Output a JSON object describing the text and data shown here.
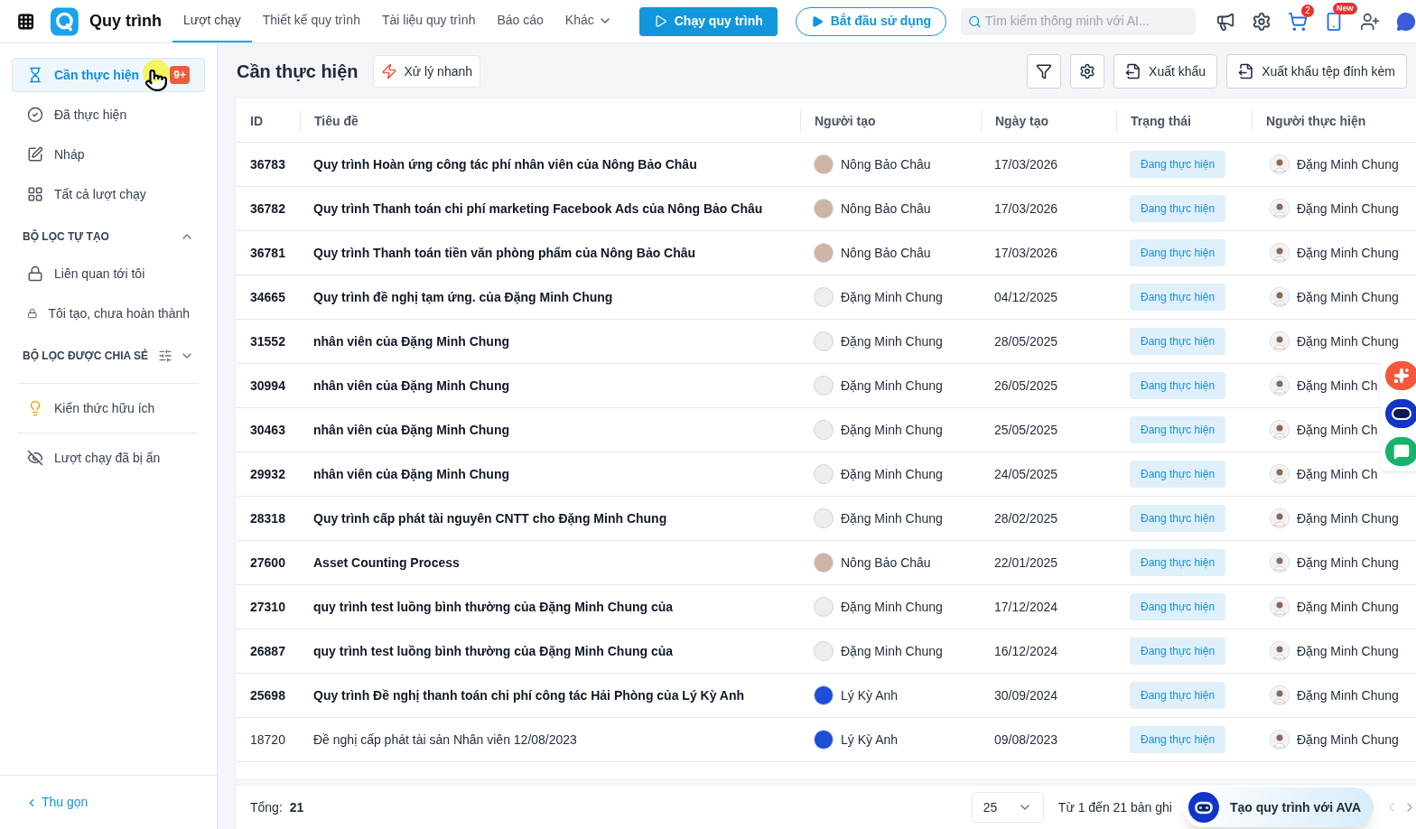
{
  "app": {
    "title": "Quy trình"
  },
  "nav_tabs": [
    {
      "label": "Lượt chạy",
      "selected": true
    },
    {
      "label": "Thiết kế quy trình",
      "selected": false
    },
    {
      "label": "Tài liệu quy trình",
      "selected": false
    },
    {
      "label": "Báo cáo",
      "selected": false
    },
    {
      "label": "Khác",
      "selected": false,
      "dropdown": true
    }
  ],
  "buttons": {
    "run": "Chạy quy trình",
    "start": "Bắt đầu sử dụng"
  },
  "search": {
    "placeholder": "Tìm kiếm thông minh với AI..."
  },
  "header_badges": {
    "cart": "2",
    "phone": "New"
  },
  "sidebar": {
    "items": [
      {
        "label": "Cần thực hiện",
        "selected": true,
        "badge": "9+"
      },
      {
        "label": "Đã thực hiện",
        "selected": false
      },
      {
        "label": "Nháp",
        "selected": false
      },
      {
        "label": "Tất cả lượt chạy",
        "selected": false
      }
    ],
    "sections": [
      {
        "title": "BỘ LỌC TỰ TẠO",
        "expanded": true,
        "items": [
          {
            "label": "Liên quan tới tôi",
            "selected": false
          },
          {
            "label": "Tôi tạo, chưa hoàn thành",
            "selected": false
          }
        ]
      },
      {
        "title": "BỘ LỌC ĐƯỢC CHIA SẺ",
        "expanded": false
      }
    ],
    "extra_items": [
      {
        "label": "Kiến thức hữu ích",
        "selected": false
      },
      {
        "label": "Lượt chạy đã bị ẩn",
        "selected": false
      }
    ],
    "collapse": "Thu gọn"
  },
  "toolbar": {
    "title": "Cần thực hiện",
    "quick": "Xử lý nhanh",
    "export": "Xuất khẩu",
    "export_attachments": "Xuất khẩu tệp đính kèm"
  },
  "table": {
    "columns": [
      "ID",
      "Tiêu đề",
      "Người tạo",
      "Ngày tạo",
      "Trạng thái",
      "Người thực hiện"
    ],
    "rows": [
      {
        "id": "36783",
        "title": "Quy trình Hoàn ứng công tác phí nhân viên của Nông Bảo Châu",
        "creator": {
          "name": "Nông Bảo Châu",
          "color": "#cdb4a4"
        },
        "date": "17/03/2026",
        "status": "Đang thực hiện",
        "assignee": "Đặng Minh Chung",
        "unread": true
      },
      {
        "id": "36782",
        "title": "Quy trình Thanh toán chi phí marketing Facebook Ads của Nông Bảo Châu",
        "creator": {
          "name": "Nông Bảo Châu",
          "color": "#cdb4a4"
        },
        "date": "17/03/2026",
        "status": "Đang thực hiện",
        "assignee": "Đặng Minh Chung",
        "unread": true
      },
      {
        "id": "36781",
        "title": "Quy trình Thanh toán tiền văn phòng phẩm của Nông Bảo Châu",
        "creator": {
          "name": "Nông Bảo Châu",
          "color": "#cdb4a4"
        },
        "date": "17/03/2026",
        "status": "Đang thực hiện",
        "assignee": "Đặng Minh Chung",
        "unread": true
      },
      {
        "id": "34665",
        "title": "Quy trình đề nghị tạm ứng. của Đặng Minh Chung",
        "creator": {
          "name": "Đặng Minh Chung",
          "color": "#eeeeee"
        },
        "date": "04/12/2025",
        "status": "Đang thực hiện",
        "assignee": "Đặng Minh Chung",
        "unread": true
      },
      {
        "id": "31552",
        "title": "nhân viên của Đặng Minh Chung",
        "creator": {
          "name": "Đặng Minh Chung",
          "color": "#eeeeee"
        },
        "date": "28/05/2025",
        "status": "Đang thực hiện",
        "assignee": "Đặng Minh Chung",
        "unread": true
      },
      {
        "id": "30994",
        "title": "nhân viên của Đặng Minh Chung",
        "creator": {
          "name": "Đặng Minh Chung",
          "color": "#eeeeee"
        },
        "date": "26/05/2025",
        "status": "Đang thực hiện",
        "assignee": "Đặng Minh Ch",
        "unread": true
      },
      {
        "id": "30463",
        "title": "nhân viên của Đặng Minh Chung",
        "creator": {
          "name": "Đặng Minh Chung",
          "color": "#eeeeee"
        },
        "date": "25/05/2025",
        "status": "Đang thực hiện",
        "assignee": "Đặng Minh Ch",
        "unread": true
      },
      {
        "id": "29932",
        "title": "nhân viên của Đặng Minh Chung",
        "creator": {
          "name": "Đặng Minh Chung",
          "color": "#eeeeee"
        },
        "date": "24/05/2025",
        "status": "Đang thực hiện",
        "assignee": "Đặng Minh Ch",
        "unread": true
      },
      {
        "id": "28318",
        "title": "Quy trình cấp phát tài nguyên CNTT cho Đặng Minh Chung",
        "creator": {
          "name": "Đặng Minh Chung",
          "color": "#eeeeee"
        },
        "date": "28/02/2025",
        "status": "Đang thực hiện",
        "assignee": "Đặng Minh Chung",
        "unread": true
      },
      {
        "id": "27600",
        "title": "Asset Counting Process",
        "creator": {
          "name": "Nông Bảo Châu",
          "color": "#cdb4a4"
        },
        "date": "22/01/2025",
        "status": "Đang thực hiện",
        "assignee": "Đặng Minh Chung",
        "unread": true
      },
      {
        "id": "27310",
        "title": "quy trình test luồng bình thường của Đặng Minh Chung của",
        "creator": {
          "name": "Đặng Minh Chung",
          "color": "#eeeeee"
        },
        "date": "17/12/2024",
        "status": "Đang thực hiện",
        "assignee": "Đặng Minh Chung",
        "unread": true
      },
      {
        "id": "26887",
        "title": "quy trình test luồng bình thường của Đặng Minh Chung của",
        "creator": {
          "name": "Đặng Minh Chung",
          "color": "#eeeeee"
        },
        "date": "16/12/2024",
        "status": "Đang thực hiện",
        "assignee": "Đặng Minh Chung",
        "unread": true
      },
      {
        "id": "25698",
        "title": "Quy trình Đề nghị thanh toán chi phí công tác Hải Phòng của Lý Kỳ Anh",
        "creator": {
          "name": "Lý Kỳ Anh",
          "color": "#1d4ed8"
        },
        "date": "30/09/2024",
        "status": "Đang thực hiện",
        "assignee": "Đặng Minh Chung",
        "unread": true
      },
      {
        "id": "18720",
        "title": "Đề nghị cấp phát tài sản Nhân viên 12/08/2023",
        "creator": {
          "name": "Lý Kỳ Anh",
          "color": "#1d4ed8"
        },
        "date": "09/08/2023",
        "status": "Đang thực hiện",
        "assignee": "Đặng Minh Chung",
        "unread": false
      }
    ]
  },
  "footer": {
    "total_label": "Tổng:",
    "total": "21",
    "page_size": "25",
    "range": "Từ 1 đến 21 bản ghi"
  },
  "ava_popup": {
    "label": "Tạo quy trình với AVA"
  }
}
